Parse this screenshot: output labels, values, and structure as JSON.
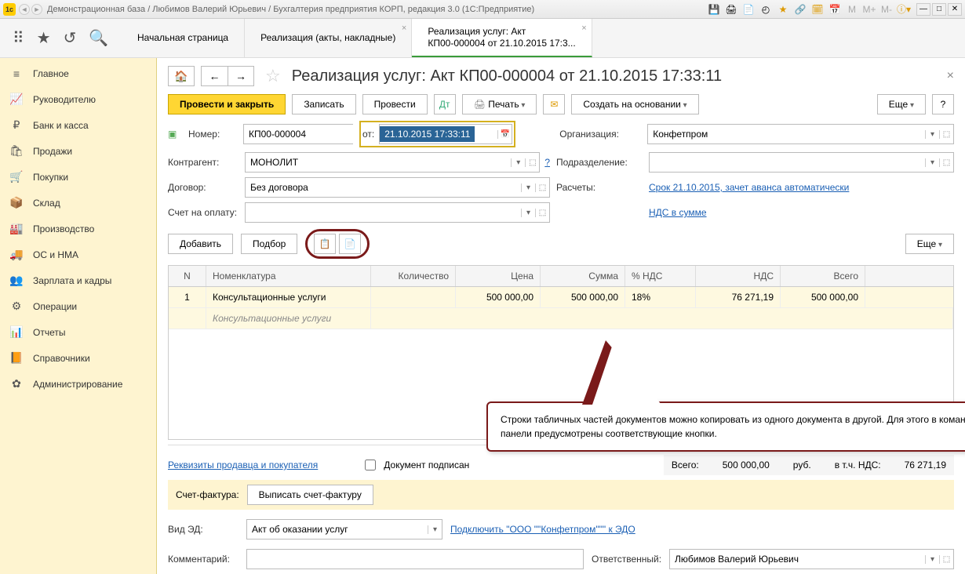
{
  "titlebar": {
    "text": "Демонстрационная база / Любимов Валерий Юрьевич / Бухгалтерия предприятия КОРП, редакция 3.0  (1С:Предприятие)",
    "m_labels": {
      "m": "M",
      "mp": "M+",
      "mm": "M-"
    }
  },
  "tabs": {
    "start": "Начальная страница",
    "realiz": "Реализация (акты, накладные)",
    "active1": "Реализация услуг: Акт",
    "active2": "КП00-000004 от 21.10.2015 17:3..."
  },
  "sidebar": [
    {
      "icon": "≡",
      "label": "Главное"
    },
    {
      "icon": "📈",
      "label": "Руководителю"
    },
    {
      "icon": "₽",
      "label": "Банк и касса"
    },
    {
      "icon": "🛍",
      "label": "Продажи"
    },
    {
      "icon": "🛒",
      "label": "Покупки"
    },
    {
      "icon": "📦",
      "label": "Склад"
    },
    {
      "icon": "🏭",
      "label": "Производство"
    },
    {
      "icon": "🚚",
      "label": "ОС и НМА"
    },
    {
      "icon": "👥",
      "label": "Зарплата и кадры"
    },
    {
      "icon": "⚙",
      "label": "Операции"
    },
    {
      "icon": "📊",
      "label": "Отчеты"
    },
    {
      "icon": "📙",
      "label": "Справочники"
    },
    {
      "icon": "✿",
      "label": "Администрирование"
    }
  ],
  "doc": {
    "title": "Реализация услуг: Акт КП00-000004 от 21.10.2015 17:33:11",
    "actions": {
      "post_close": "Провести и закрыть",
      "write": "Записать",
      "post": "Провести",
      "print": "Печать",
      "create_base": "Создать на основании",
      "more": "Еще"
    },
    "fields": {
      "number_label": "Номер:",
      "number": "КП00-000004",
      "date_label": "от:",
      "date": "21.10.2015 17:33:11",
      "org_label": "Организация:",
      "org": "Конфетпром",
      "contragent_label": "Контрагент:",
      "contragent": "МОНОЛИТ",
      "subdiv_label": "Подразделение:",
      "contract_label": "Договор:",
      "contract": "Без договора",
      "calc_label": "Расчеты:",
      "calc_link": "Срок 21.10.2015, зачет аванса автоматически",
      "invoice_label": "Счет на оплату:",
      "vat_link": "НДС в сумме"
    },
    "tablebar": {
      "add": "Добавить",
      "pick": "Подбор",
      "more": "Еще"
    },
    "cols": {
      "n": "N",
      "nom": "Номенклатура",
      "qty": "Количество",
      "price": "Цена",
      "sum": "Сумма",
      "vat": "% НДС",
      "vatsum": "НДС",
      "total": "Всего"
    },
    "row": {
      "n": "1",
      "nom": "Консультационные услуги",
      "nom2": "Консультационные услуги",
      "price": "500 000,00",
      "sum": "500 000,00",
      "vat": "18%",
      "vatsum": "76 271,19",
      "total": "500 000,00"
    },
    "callout": "Строки табличных частей документов можно копировать из одного документа в другой. Для этого в командной панели предусмотрены соответствующие кнопки.",
    "footer": {
      "requisites": "Реквизиты продавца и покупателя",
      "signed": "Документ подписан",
      "total_label": "Всего:",
      "total": "500 000,00",
      "curr": "руб.",
      "vat_inc": "в т.ч. НДС:",
      "vat": "76 271,19",
      "sf_label": "Счет-фактура:",
      "sf_button": "Выписать счет-фактуру",
      "ed_label": "Вид ЭД:",
      "ed_value": "Акт об оказании услуг",
      "ed_link": "Подключить \"ООО \"\"Конфетпром\"\"\" к ЭДО",
      "comment_label": "Комментарий:",
      "resp_label": "Ответственный:",
      "resp": "Любимов Валерий Юрьевич"
    }
  }
}
